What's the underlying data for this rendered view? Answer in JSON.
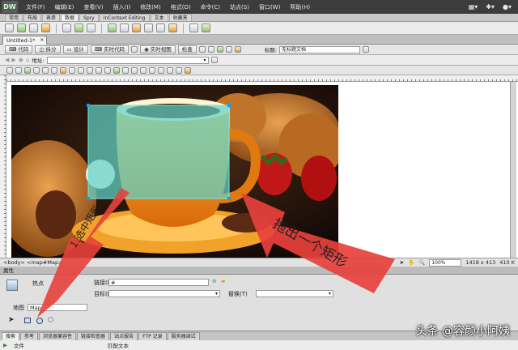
{
  "app": {
    "logo": "DW",
    "menu": [
      "文件(F)",
      "编辑(E)",
      "查看(V)",
      "插入(I)",
      "修改(M)",
      "格式(O)",
      "命令(C)",
      "站点(S)",
      "窗口(W)",
      "帮助(H)"
    ],
    "right_icons": [
      "layout-icon",
      "gear-icon",
      "user-icon"
    ]
  },
  "insert_tabs": {
    "items": [
      "常用",
      "布局",
      "表单",
      "数据",
      "Spry",
      "InContext Editing",
      "文本",
      "收藏夹"
    ],
    "active_index": 3
  },
  "document": {
    "tab_title": "Untitled-1*",
    "tab_close": "×",
    "view_buttons": {
      "code": "代码",
      "split": "拆分",
      "design": "设计",
      "live_code": "实时代码",
      "live_view": "实时视图",
      "inspect": "检查"
    },
    "title_label": "标题:",
    "title_value": "无标题文档",
    "address_label": "地址:"
  },
  "status_bar": {
    "tag_selector": "<body> <map#Map>",
    "zoom": "100%",
    "dimensions": "1418 x 413",
    "size_suffix": "410 K"
  },
  "properties": {
    "panel_title": "属性",
    "hotspot_label": "热点",
    "link_label": "链接(L)",
    "link_value": "#",
    "target_label": "目标(R)",
    "alt_label": "替换(T)",
    "map_label": "地图",
    "map_value": "Map"
  },
  "panels": {
    "tabs": [
      "搜索",
      "参考",
      "浏览器兼容性",
      "链接检查器",
      "站点报告",
      "FTP 记录",
      "服务器调试"
    ],
    "active_index": 0,
    "col_file": "文件",
    "col_text": "匹配文本"
  },
  "annotations": {
    "select_rect": "1.选中矩形",
    "drag_rect": "拖出一个矩形"
  },
  "watermark": "头条 @容颜小阿姨",
  "colors": {
    "hotspot": "#5fd3c8",
    "arrow": "#e8413c"
  }
}
